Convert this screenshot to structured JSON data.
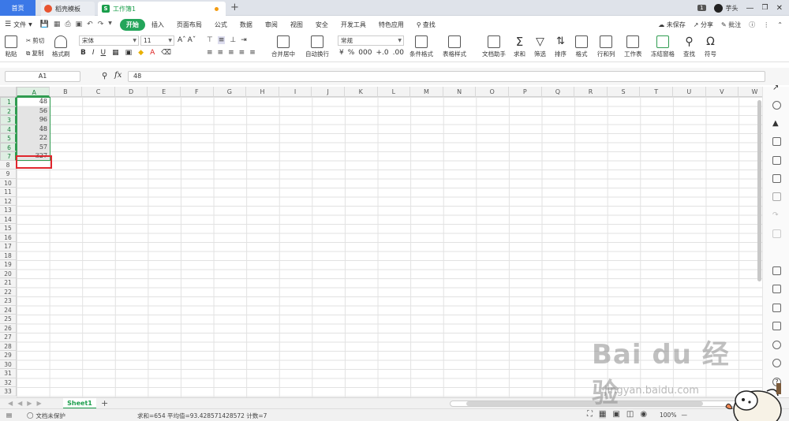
{
  "tabs": {
    "home": "首页",
    "template": "稻壳模板",
    "workbook": "工作簿1",
    "new_tab": "+"
  },
  "window": {
    "badge": "1",
    "user": "芋头"
  },
  "menu": {
    "file": "文件",
    "items": [
      "开始",
      "插入",
      "页面布局",
      "公式",
      "数据",
      "审阅",
      "视图",
      "安全",
      "开发工具",
      "特色应用"
    ],
    "search": "查找",
    "unsaved": "未保存",
    "share": "分享",
    "comment": "批注"
  },
  "ribbon": {
    "paste": "粘贴",
    "cut": "剪切",
    "copy": "复制",
    "format_painter": "格式刷",
    "font_name": "宋体",
    "font_size": "11",
    "merge_center": "合并居中",
    "wrap_text": "自动换行",
    "number_format": "常规",
    "cond_format": "条件格式",
    "table_style": "表格样式",
    "doc_helper": "文档助手",
    "sum": "求和",
    "filter": "筛选",
    "sort": "排序",
    "format": "格式",
    "row_col": "行和列",
    "worksheet": "工作表",
    "freeze": "冻结窗格",
    "find": "查找",
    "symbol": "符号"
  },
  "formula_bar": {
    "name_box": "A1",
    "fx": "fx",
    "content": "48"
  },
  "grid": {
    "columns": [
      "A",
      "B",
      "C",
      "D",
      "E",
      "F",
      "G",
      "H",
      "I",
      "J",
      "K",
      "L",
      "M",
      "N",
      "O",
      "P",
      "Q",
      "R",
      "S",
      "T",
      "U",
      "V",
      "W"
    ],
    "rows": [
      "1",
      "2",
      "3",
      "4",
      "5",
      "6",
      "7",
      "8",
      "9",
      "10",
      "11",
      "12",
      "13",
      "14",
      "15",
      "16",
      "17",
      "18",
      "19",
      "20",
      "21",
      "22",
      "23",
      "24",
      "25",
      "26",
      "27",
      "28",
      "29",
      "30",
      "31",
      "32",
      "33"
    ],
    "col_a_values": [
      "48",
      "56",
      "96",
      "48",
      "22",
      "57",
      "327"
    ]
  },
  "sheets": {
    "active": "Sheet1",
    "add": "+"
  },
  "status": {
    "protect": "文档未保护",
    "summary": "求和=654  平均值=93.428571428572  计数=7",
    "zoom": "100%"
  },
  "watermark": {
    "brand": "Bai du 经验",
    "url": "jingyan.baidu.com"
  },
  "colors": {
    "accent_green": "#23a55a",
    "home_blue": "#3b78e7",
    "highlight_red": "#e0262e",
    "selection_green": "#2f9c50"
  }
}
